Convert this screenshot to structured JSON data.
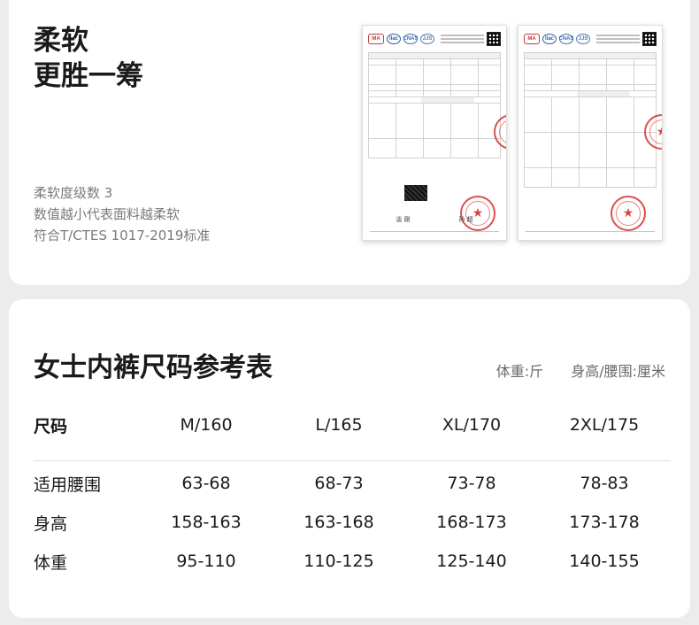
{
  "softness": {
    "headline": [
      "柔软",
      "更胜一筹"
    ],
    "details": [
      "柔软度级数  3",
      "数值越小代表面料越柔软",
      "符合T/CTES 1017-2019标准"
    ],
    "reports": [
      {
        "logos": [
          "MA",
          "ilac",
          "CNAS",
          "JJS"
        ],
        "signatures": [
          "谈 刚",
          "孙 超"
        ]
      },
      {
        "logos": [
          "MA",
          "ilac",
          "CNAS",
          "JJS"
        ],
        "signatures": []
      }
    ],
    "colors": {
      "stamp": "#d63030"
    }
  },
  "size_chart": {
    "title": "女士内裤尺码参考表",
    "units": [
      "体重:斤",
      "身高/腰围:厘米"
    ],
    "header_label": "尺码",
    "sizes": [
      "M/160",
      "L/165",
      "XL/170",
      "2XL/175"
    ],
    "rows": [
      {
        "label": "适用腰围",
        "values": [
          "63-68",
          "68-73",
          "73-78",
          "78-83"
        ]
      },
      {
        "label": "身高",
        "values": [
          "158-163",
          "163-168",
          "168-173",
          "173-178"
        ]
      },
      {
        "label": "体重",
        "values": [
          "95-110",
          "110-125",
          "125-140",
          "140-155"
        ]
      }
    ]
  }
}
